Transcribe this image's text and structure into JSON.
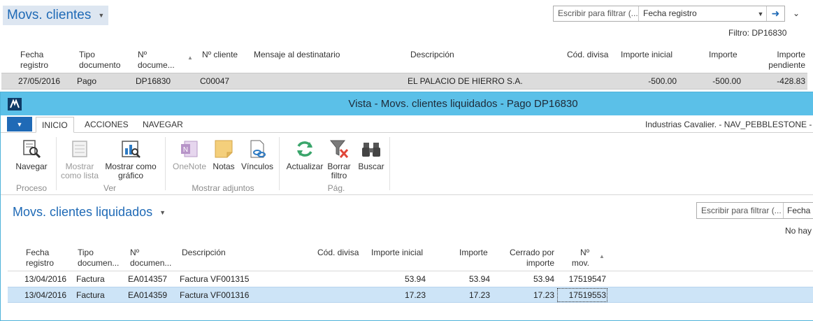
{
  "page": {
    "title": "Movs. clientes",
    "filter_placeholder": "Escribir para filtrar (...",
    "filter_field": "Fecha registro",
    "filter_summary": "Filtro: DP16830",
    "columns": [
      "Fecha registro",
      "Tipo documento",
      "Nº docume...",
      "Nº cliente",
      "Mensaje al destinatario",
      "Descripción",
      "Cód. divisa",
      "Importe inicial",
      "Importe",
      "Importe pendiente"
    ],
    "row": {
      "fecha": "27/05/2016",
      "tipo": "Pago",
      "documento": "DP16830",
      "cliente": "C00047",
      "mensaje": "",
      "descripcion": "EL PALACIO DE HIERRO S.A.",
      "divisa": "",
      "importe_inicial": "-500.00",
      "importe": "-500.00",
      "importe_pendiente": "-428.83"
    }
  },
  "window": {
    "title": "Vista - Movs. clientes liquidados - Pago DP16830",
    "tabs": [
      "INICIO",
      "ACCIONES",
      "NAVEGAR"
    ],
    "active_tab": "INICIO",
    "company": "Industrias Cavalier. - NAV_PEBBLESTONE - svr",
    "ribbon": {
      "groups": [
        {
          "label": "Proceso",
          "buttons": [
            {
              "label": "Navegar",
              "icon": "navigate-icon",
              "enabled": true
            }
          ]
        },
        {
          "label": "Ver",
          "buttons": [
            {
              "label": "Mostrar como lista",
              "icon": "list-view-icon",
              "enabled": false
            },
            {
              "label": "Mostrar como gráfico",
              "icon": "chart-view-icon",
              "enabled": true
            }
          ]
        },
        {
          "label": "Mostrar adjuntos",
          "buttons": [
            {
              "label": "OneNote",
              "icon": "onenote-icon",
              "enabled": false
            },
            {
              "label": "Notas",
              "icon": "notes-icon",
              "enabled": true
            },
            {
              "label": "Vínculos",
              "icon": "links-icon",
              "enabled": true
            }
          ]
        },
        {
          "label": "Pág.",
          "buttons": [
            {
              "label": "Actualizar",
              "icon": "refresh-icon",
              "enabled": true
            },
            {
              "label": "Borrar filtro",
              "icon": "clear-filter-icon",
              "enabled": true
            },
            {
              "label": "Buscar",
              "icon": "binoculars-icon",
              "enabled": true
            }
          ]
        }
      ]
    },
    "subpage": {
      "title": "Movs. clientes liquidados",
      "filter_placeholder": "Escribir para filtrar (...",
      "filter_field": "Fecha r",
      "no_filter_text": "No hay",
      "columns": [
        "Fecha registro",
        "Tipo documen...",
        "Nº documen...",
        "Descripción",
        "Cód. divisa",
        "Importe inicial",
        "Importe",
        "Cerrado por importe",
        "Nº mov."
      ],
      "rows": [
        {
          "fecha": "13/04/2016",
          "tipo": "Factura",
          "documento": "EA014357",
          "descripcion": "Factura VF001315",
          "divisa": "",
          "importe_inicial": "53.94",
          "importe": "53.94",
          "cerrado": "53.94",
          "mov": "17519547"
        },
        {
          "fecha": "13/04/2016",
          "tipo": "Factura",
          "documento": "EA014359",
          "descripcion": "Factura VF001316",
          "divisa": "",
          "importe_inicial": "17.23",
          "importe": "17.23",
          "cerrado": "17.23",
          "mov": "17519553"
        }
      ]
    }
  },
  "colors": {
    "accent": "#1f6ab6",
    "titlebar": "#5bc0e8",
    "selected_row": "#cde4f7",
    "bg_selected_row": "#dcdcdc"
  }
}
